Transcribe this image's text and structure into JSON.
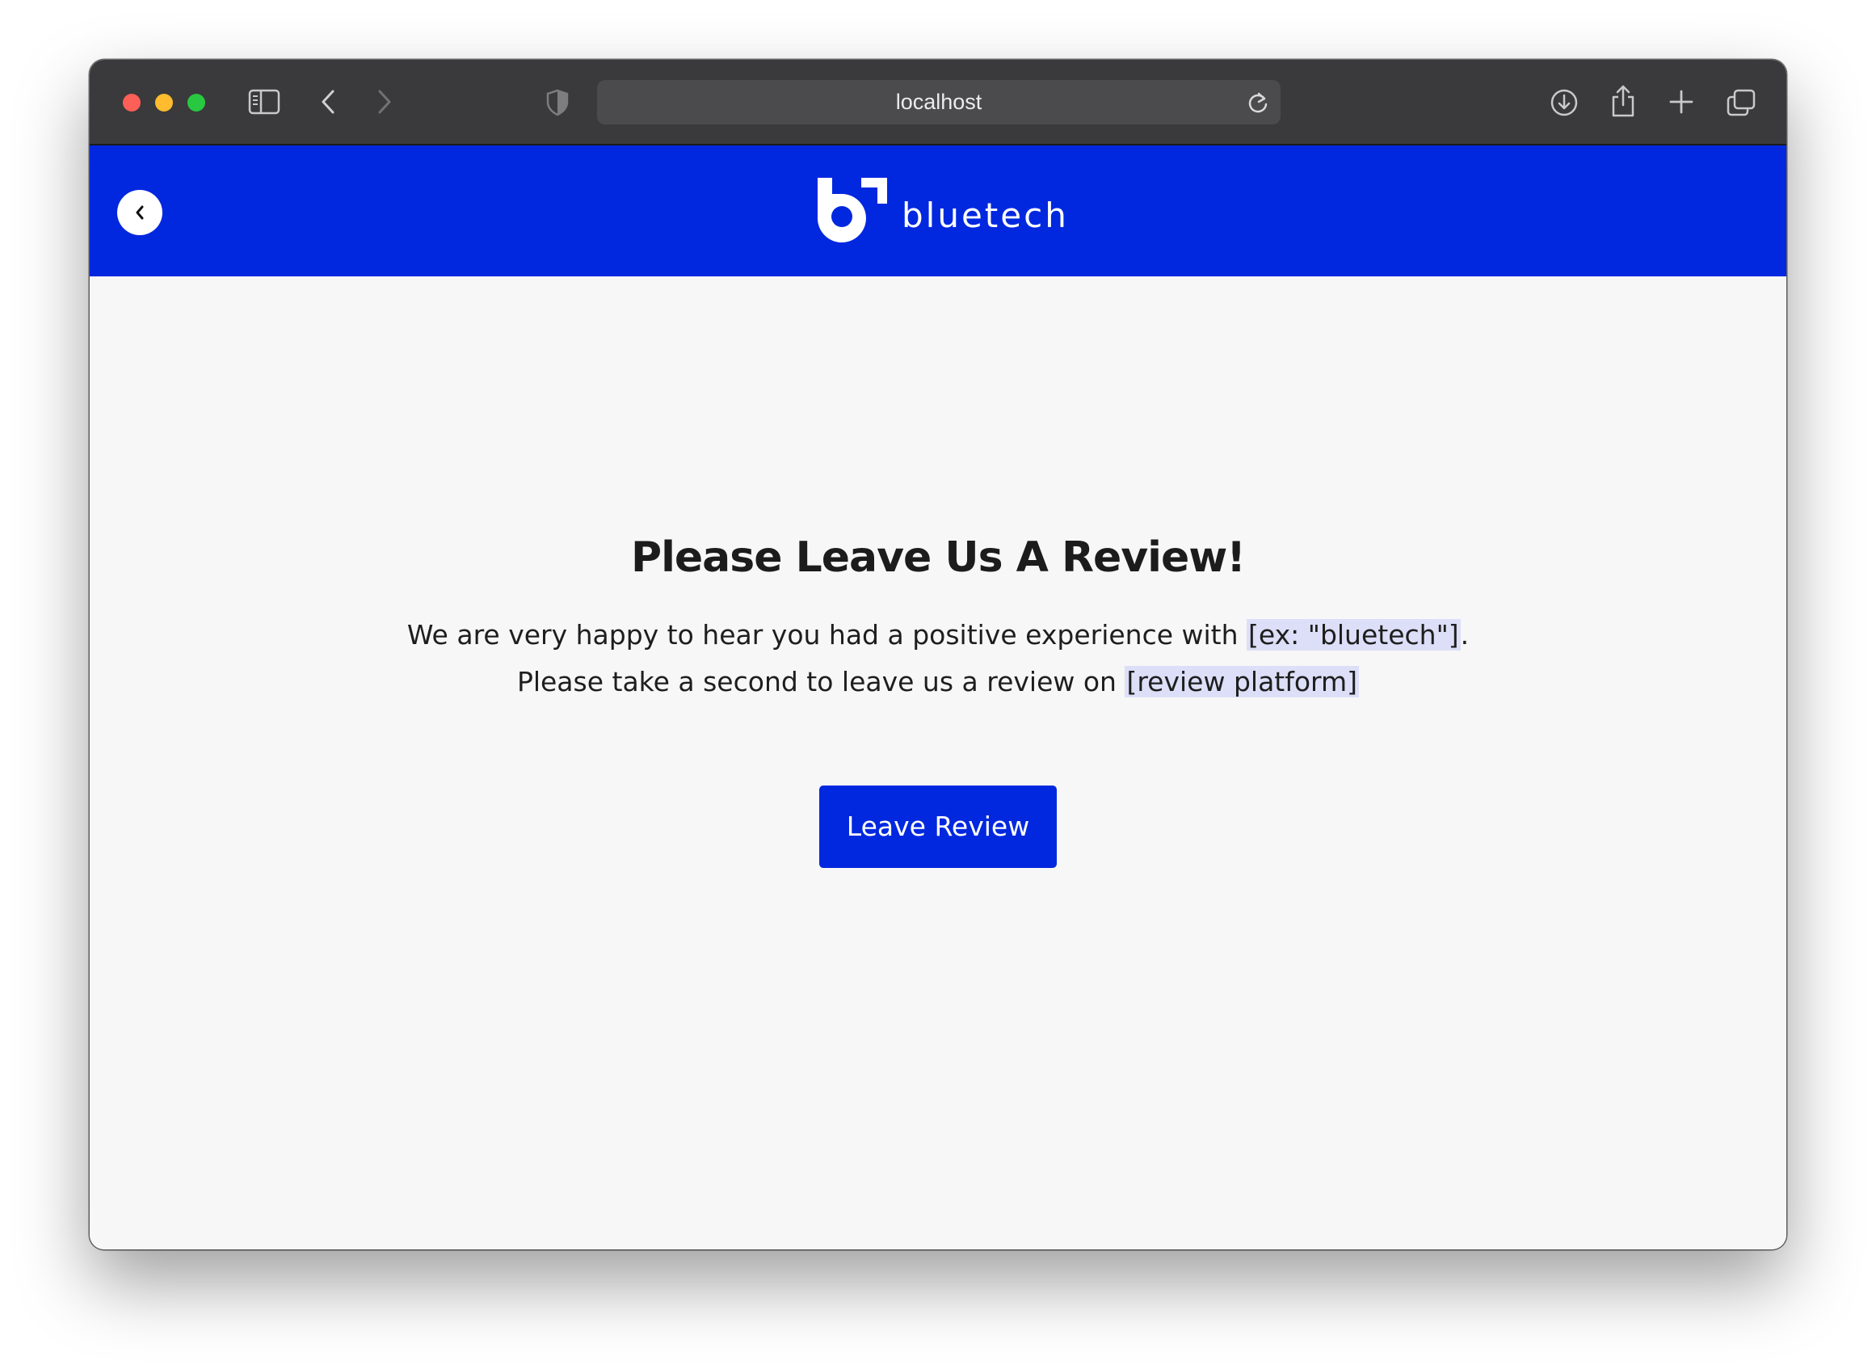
{
  "browser": {
    "url": "localhost",
    "icons": [
      "sidebar-icon",
      "back-arrow-icon",
      "forward-arrow-icon",
      "shield-icon",
      "reload-icon",
      "download-icon",
      "share-icon",
      "new-tab-icon",
      "tabs-overview-icon"
    ]
  },
  "site": {
    "brand_name": "bluetech",
    "brand_color": "#0228df",
    "back_glyph": "‹"
  },
  "review": {
    "heading": "Please Leave Us A Review!",
    "line1_prefix": "We are very happy to hear you had a positive experience with ",
    "line1_placeholder": "[ex: \"bluetech\"]",
    "line1_suffix": ".",
    "line2_prefix": "Please take a second to leave us a review on ",
    "line2_placeholder": "[review platform]",
    "button_label": "Leave Review"
  }
}
